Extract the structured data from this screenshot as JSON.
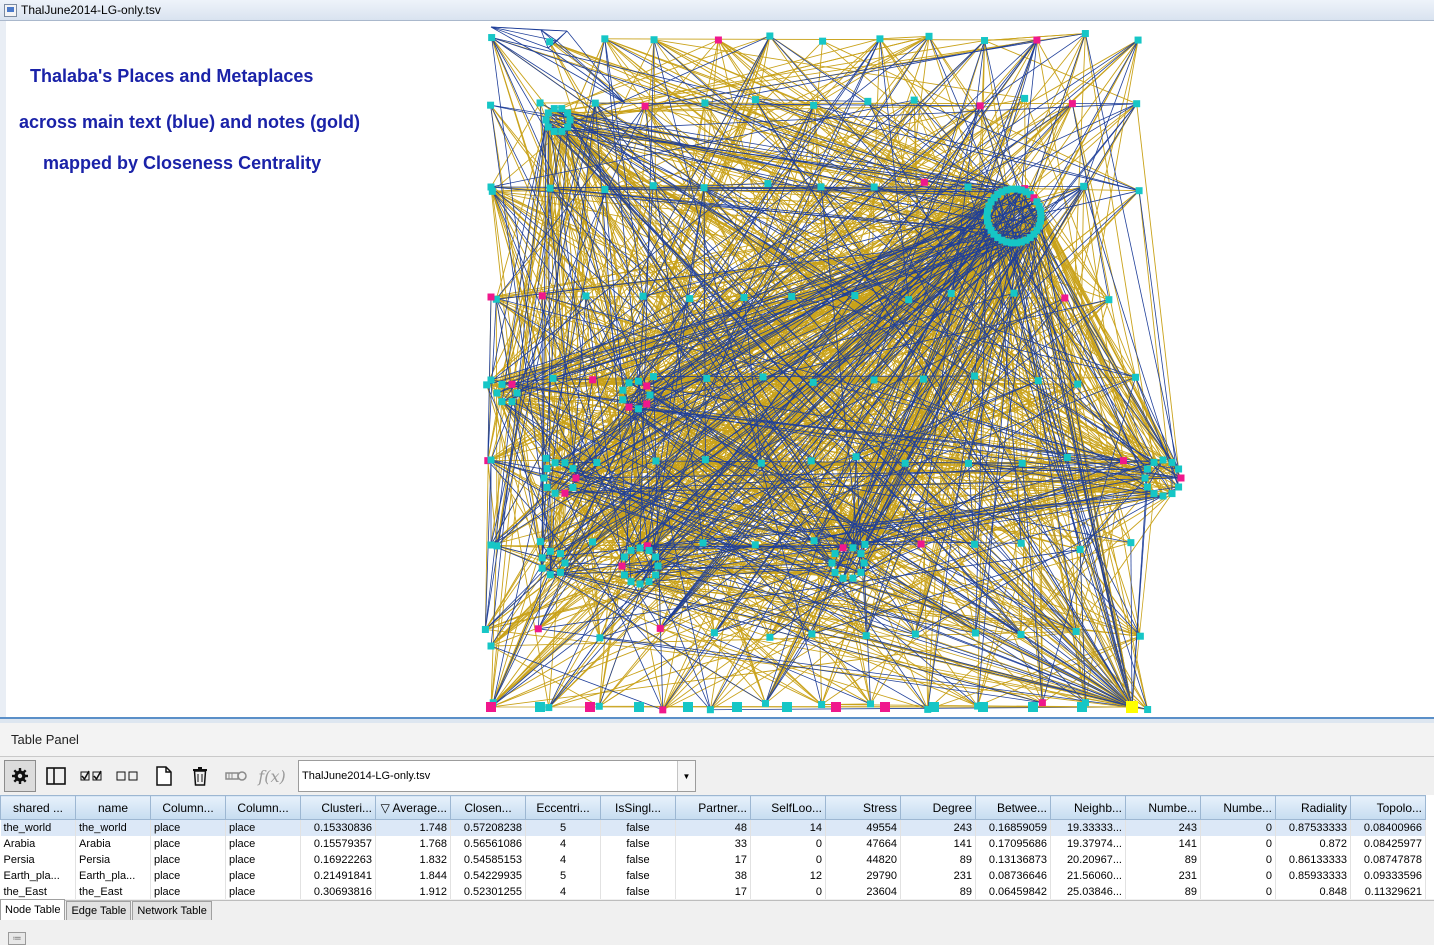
{
  "window": {
    "title": "ThalJune2014-LG-only.tsv"
  },
  "network": {
    "title_lines": [
      "Thalaba's Places and Metaplaces",
      "across main text (blue) and notes (gold)",
      "mapped by Closeness Centrality"
    ],
    "colors": {
      "main_text_edge": "#1f3f99",
      "notes_edge": "#c9a21a",
      "node_cyan": "#16c6c6",
      "node_magenta": "#f0188c",
      "node_yellow": "#ffff00",
      "title_text": "#1a22a8"
    }
  },
  "panel": {
    "title": "Table Panel"
  },
  "toolbar": {
    "buttons": [
      {
        "icon": "gear-icon",
        "pressed": true
      },
      {
        "icon": "columns-icon",
        "pressed": false
      },
      {
        "icon": "select-all-icon",
        "pressed": false
      },
      {
        "icon": "deselect-all-icon",
        "pressed": false
      },
      {
        "icon": "new-column-icon",
        "pressed": false
      },
      {
        "icon": "trash-icon",
        "pressed": false
      },
      {
        "icon": "link-icon",
        "pressed": false
      },
      {
        "icon": "function-icon",
        "label": "f(x)",
        "pressed": false
      }
    ],
    "table_select_value": "ThalJune2014-LG-only.tsv"
  },
  "table": {
    "columns": [
      {
        "label": "shared ...",
        "align": "ctr"
      },
      {
        "label": "name",
        "align": "ctr"
      },
      {
        "label": "Column...",
        "align": "ctr"
      },
      {
        "label": "Column...",
        "align": "ctr"
      },
      {
        "label": "Clusteri...",
        "align": "num"
      },
      {
        "label": "▽ Average...",
        "align": "num"
      },
      {
        "label": "Closen...",
        "align": "ctr"
      },
      {
        "label": "Eccentri...",
        "align": "ctr"
      },
      {
        "label": "IsSingl...",
        "align": "ctr"
      },
      {
        "label": "Partner...",
        "align": "num"
      },
      {
        "label": "SelfLoo...",
        "align": "num"
      },
      {
        "label": "Stress",
        "align": "num"
      },
      {
        "label": "Degree",
        "align": "num"
      },
      {
        "label": "Betwee...",
        "align": "num"
      },
      {
        "label": "Neighb...",
        "align": "num"
      },
      {
        "label": "Numbe...",
        "align": "num"
      },
      {
        "label": "Numbe...",
        "align": "num"
      },
      {
        "label": "Radiality",
        "align": "num"
      },
      {
        "label": "Topolo...",
        "align": "num"
      }
    ],
    "rows": [
      [
        "the_world",
        "the_world",
        "place",
        "place",
        "0.15330836",
        "1.748",
        "0.57208238",
        "5",
        "false",
        "48",
        "14",
        "49554",
        "243",
        "0.16859059",
        "19.33333...",
        "243",
        "0",
        "0.87533333",
        "0.08400966"
      ],
      [
        "Arabia",
        "Arabia",
        "place",
        "place",
        "0.15579357",
        "1.768",
        "0.56561086",
        "4",
        "false",
        "33",
        "0",
        "47664",
        "141",
        "0.17095686",
        "19.37974...",
        "141",
        "0",
        "0.872",
        "0.08425977"
      ],
      [
        "Persia",
        "Persia",
        "place",
        "place",
        "0.16922263",
        "1.832",
        "0.54585153",
        "4",
        "false",
        "17",
        "0",
        "44820",
        "89",
        "0.13136873",
        "20.20967...",
        "89",
        "0",
        "0.86133333",
        "0.08747878"
      ],
      [
        "Earth_pla...",
        "Earth_pla...",
        "place",
        "place",
        "0.21491841",
        "1.844",
        "0.54229935",
        "5",
        "false",
        "38",
        "12",
        "29790",
        "231",
        "0.08736646",
        "21.56060...",
        "231",
        "0",
        "0.85933333",
        "0.09333596"
      ],
      [
        "the_East",
        "the_East",
        "place",
        "place",
        "0.30693816",
        "1.912",
        "0.52301255",
        "4",
        "false",
        "17",
        "0",
        "23604",
        "89",
        "0.06459842",
        "25.03846...",
        "89",
        "0",
        "0.848",
        "0.11329621"
      ]
    ]
  },
  "tabs": [
    "Node Table",
    "Edge Table",
    "Network Table"
  ],
  "active_tab": 0
}
